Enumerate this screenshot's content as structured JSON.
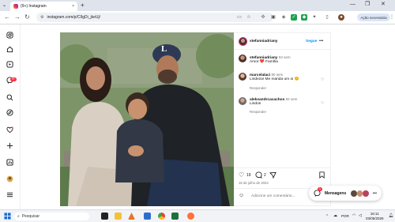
{
  "browser": {
    "tab_title": "(9+) Instagram",
    "tab_close": "×",
    "new_tab": "+",
    "url": "instagram.com/p/C9gDi_jkeUj/",
    "update_label": "Ação necessária",
    "win_min": "—",
    "win_max": "❐",
    "win_close": "✕"
  },
  "sidebar": {
    "notif_badge": "9+"
  },
  "post": {
    "author": "stefanniadriany",
    "follow": "Segue",
    "more": "•••",
    "caption": {
      "user": "stefanniadriany",
      "time": "94 sem",
      "text": "Amor ❤️ Família"
    },
    "comments": [
      {
        "user": "marcelalaci",
        "time": "80 sem",
        "text": "Lindeza! Me manda um oi 😊",
        "reply": "Responder"
      },
      {
        "user": "aleksandrcacachos",
        "time": "92 sem",
        "text": "Lindos",
        "reply": "Responder"
      }
    ],
    "likes": "19",
    "comments_count": "2",
    "date": "16 de julho de 2024",
    "add_comment_placeholder": "Adicione um comentário..."
  },
  "messages": {
    "label": "Mensagens",
    "badge": "1"
  },
  "taskbar": {
    "search": "Pesquisar",
    "lang": "POR",
    "time": "16:11",
    "date": "03/05/2026"
  },
  "colors": {
    "follow_blue": "#0095f6",
    "like_red": "#ff3040",
    "chrome_bg": "#dfe3eb"
  }
}
